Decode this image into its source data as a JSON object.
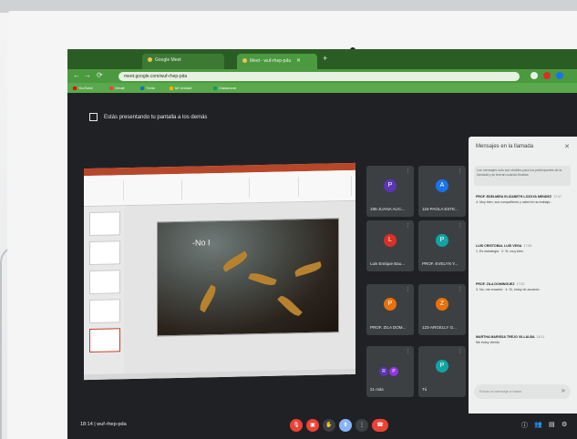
{
  "browser": {
    "tabs": [
      {
        "label": "Google Meet"
      },
      {
        "label": "Meet - wuf-rhep-pda"
      }
    ],
    "url": "meet.google.com/wuf-rhep-pda",
    "bookmarks": [
      "YouTube",
      "Gmail",
      "Trello",
      "Mi Unidad",
      "Classroom"
    ]
  },
  "meet": {
    "banner_text": "Estás presentando tu pantalla a los demás",
    "slide_text": "-No I",
    "participants": [
      {
        "name": "195-JUANA ALIC...",
        "initial": "P",
        "color": "#5c35b5"
      },
      {
        "name": "116-PAOLA ESTE...",
        "initial": "A",
        "color": "#1a73e8"
      },
      {
        "name": "Luis Enrique Bau...",
        "initial": "L",
        "color": "#d93025"
      },
      {
        "name": "PROF. EVELYN Y...",
        "initial": "P",
        "color": "#12a4a4"
      },
      {
        "name": "PROF. ZILA DOM...",
        "initial": "P",
        "color": "#e8710a"
      },
      {
        "name": "123-ARGELLY G...",
        "initial": "Z",
        "color": "#e8710a"
      },
      {
        "name": "21 más",
        "initials": [
          "R",
          "P"
        ],
        "colors": [
          "#5c35b5",
          "#9334e6"
        ]
      },
      {
        "name": "Tú",
        "initial": "P",
        "color": "#12a4a4"
      }
    ],
    "chat": {
      "title": "Mensajes en la llamada",
      "info": "Los mensajes solo son visibles para los participantes de la llamada y se borran cuando finaliza",
      "messages": [
        {
          "author": "PROF. EDELMIRA ELIZABETH LOZOYA MENDEZ",
          "time": "17:47",
          "text": "4. Muy bien, sus compañeros y usted en su trabajo..."
        },
        {
          "author": "LUIS CRISTOBAL LUIS VEGA",
          "time": "17:50",
          "text": "1. Es estrategia · 2. Si, muy bien"
        },
        {
          "author": "PROF. ZILA DOMINGUEZ",
          "time": "17:52",
          "text": "3. No, me encantó · 4. Sí, estoy de acuerdo"
        },
        {
          "author": "MARTHA MARISSA TREJO VILLALBA",
          "time": "18:11",
          "text": "Me estoy viendo"
        }
      ],
      "input_placeholder": "Envía un mensaje a todos"
    },
    "meeting_time": "18:14",
    "meeting_code": "wuf-rhep-pda"
  }
}
